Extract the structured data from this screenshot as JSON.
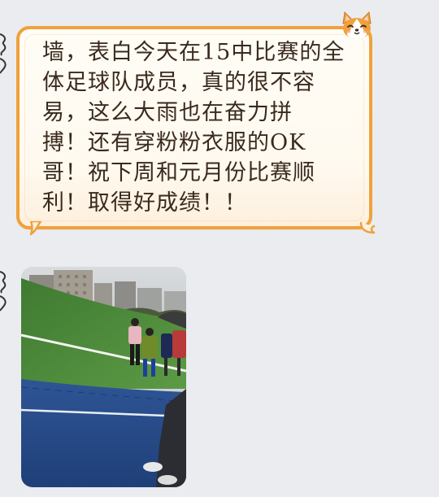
{
  "chat": {
    "message_text": "墙，表白今天在15中比赛的全\n体足球队成员，真的很不容\n易，这么大雨也在奋力拼\n搏！还有穿粉粉衣服的OK\n哥！祝下周和元月份比赛顺\n利！取得好成绩！！",
    "photo_alt": "football-match-in-rain-photo",
    "sticker_icon": "corgi-icon",
    "colors": {
      "bubble_border": "#f0a13b",
      "bubble_fill": "#fffdf7",
      "background": "#ebecf0",
      "field_green": "#4d8a3a",
      "track_blue": "#2b4f8e"
    }
  }
}
